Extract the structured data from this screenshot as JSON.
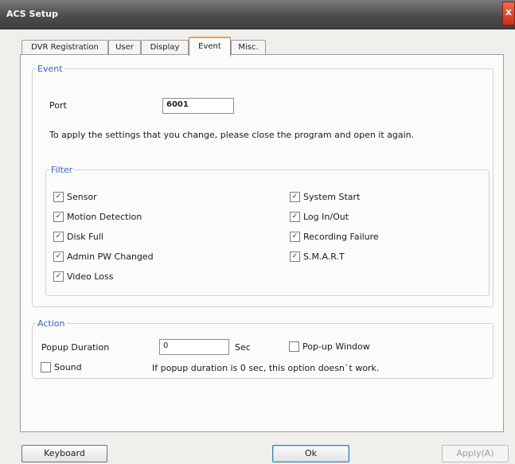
{
  "window": {
    "title": "ACS Setup",
    "close": "X"
  },
  "tabs": [
    {
      "label": "DVR Registration",
      "active": false
    },
    {
      "label": "User",
      "active": false
    },
    {
      "label": "Display",
      "active": false
    },
    {
      "label": "Event",
      "active": true
    },
    {
      "label": "Misc.",
      "active": false
    }
  ],
  "event_group": {
    "legend": "Event",
    "port_label": "Port",
    "port_value": "6001",
    "notice": "To apply the settings that you change, please close the program and open it again."
  },
  "filter_group": {
    "legend": "Filter",
    "checkboxes": [
      {
        "label": "Sensor",
        "checked": true
      },
      {
        "label": "Motion Detection",
        "checked": true
      },
      {
        "label": "Disk Full",
        "checked": true
      },
      {
        "label": "Admin PW Changed",
        "checked": true
      },
      {
        "label": "Video Loss",
        "checked": true
      },
      {
        "label": "System Start",
        "checked": true
      },
      {
        "label": "Log In/Out",
        "checked": true
      },
      {
        "label": "Recording Failure",
        "checked": true
      },
      {
        "label": "S.M.A.R.T",
        "checked": true
      }
    ]
  },
  "action_group": {
    "legend": "Action",
    "popup_duration_label": "Popup Duration",
    "popup_duration_value": "0",
    "unit": "Sec",
    "popup_window": {
      "label": "Pop-up Window",
      "checked": false
    },
    "sound": {
      "label": "Sound",
      "checked": false
    },
    "note": "If popup duration is 0 sec, this option doesn`t work."
  },
  "buttons": {
    "keyboard": "Keyboard",
    "ok": "Ok",
    "apply": "Apply(A)"
  },
  "colors": {
    "legend": "#3a62c8",
    "active_tab_accent": "#e8a43a",
    "close": "#d9442a"
  }
}
